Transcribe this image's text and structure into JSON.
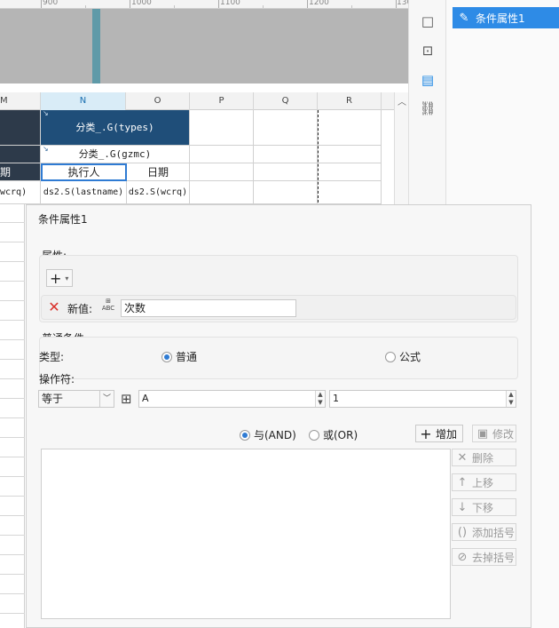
{
  "ruler": {
    "labels": [
      "900",
      "1000",
      "1100",
      "1200",
      "130"
    ]
  },
  "sheet": {
    "columns": [
      "M",
      "N",
      "O",
      "P",
      "Q",
      "R"
    ],
    "group_header": "分类_.G(types)",
    "sub_header": "分类_.G(gzmc)",
    "row3": {
      "left": "期",
      "executor": "执行人",
      "date": "日期"
    },
    "row4": {
      "left": "wcrq)",
      "n": "ds2.S(lastname)",
      "o": "ds2.S(wcrq)"
    }
  },
  "panel": {
    "condition_item": "条件属性1"
  },
  "dialog": {
    "title": "条件属性1",
    "attributes_label": "属性:",
    "add_symbol": "+",
    "new_value_label": "新值:",
    "new_value_type_icon": "ABC",
    "new_value": "次数",
    "common_condition_label": "普通条件",
    "type_label": "类型:",
    "type_normal": "普通",
    "type_formula": "公式",
    "operator_label": "操作符:",
    "operator_value": "等于",
    "field_value": "A",
    "compare_value": "1",
    "and_label": "与(AND)",
    "or_label": "或(OR)",
    "add_button": "增加",
    "modify_button": "修改",
    "delete_button": "删除",
    "move_up_button": "上移",
    "move_down_button": "下移",
    "add_bracket_button": "添加括号",
    "remove_bracket_button": "去掉括号"
  }
}
